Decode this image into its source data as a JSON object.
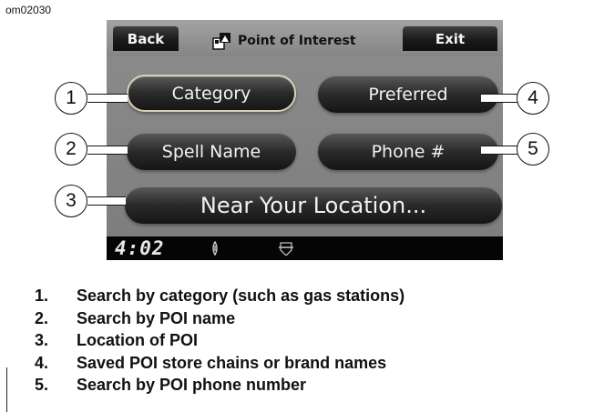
{
  "figure_id": "om02030",
  "screen": {
    "topbar": {
      "back_label": "Back",
      "title": "Point of Interest",
      "exit_label": "Exit"
    },
    "buttons": {
      "category": "Category",
      "preferred": "Preferred",
      "spell_name": "Spell Name",
      "phone": "Phone #",
      "near_location": "Near Your Location..."
    },
    "status": {
      "time": "4:02"
    }
  },
  "callouts": [
    "1",
    "2",
    "3",
    "4",
    "5"
  ],
  "legend": [
    {
      "num": "1.",
      "text": "Search by category (such as gas stations)"
    },
    {
      "num": "2.",
      "text": "Search by POI name"
    },
    {
      "num": "3.",
      "text": "Location of POI"
    },
    {
      "num": "4.",
      "text": "Saved POI store chains or brand names"
    },
    {
      "num": "5.",
      "text": "Search by POI phone number"
    }
  ]
}
